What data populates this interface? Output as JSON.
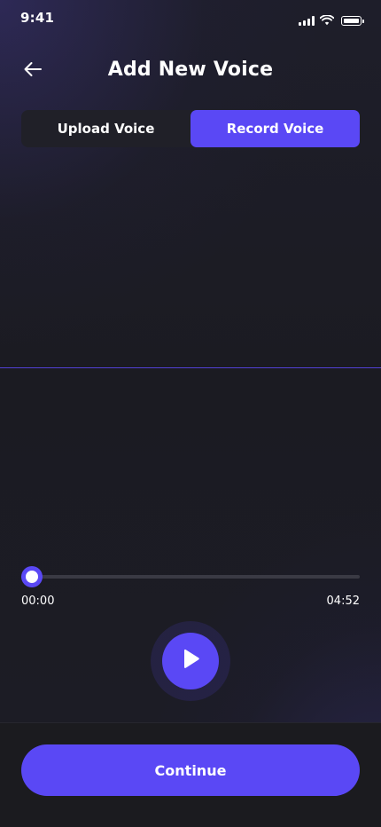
{
  "status_bar": {
    "time": "9:41",
    "icons": [
      "signal-icon",
      "wifi-icon",
      "battery-icon"
    ]
  },
  "header": {
    "title": "Add New Voice",
    "back_icon": "arrow-left-icon"
  },
  "tabs": [
    {
      "label": "Upload Voice",
      "active": false
    },
    {
      "label": "Record Voice",
      "active": true
    }
  ],
  "player": {
    "current_time": "00:00",
    "total_time": "04:52",
    "progress": 0,
    "play_icon": "play-icon"
  },
  "footer": {
    "continue_label": "Continue"
  },
  "colors": {
    "accent": "#5a48f5",
    "background": "#1b1b22",
    "track": "#3a3a44",
    "tab_inactive_bg": "#202028"
  }
}
